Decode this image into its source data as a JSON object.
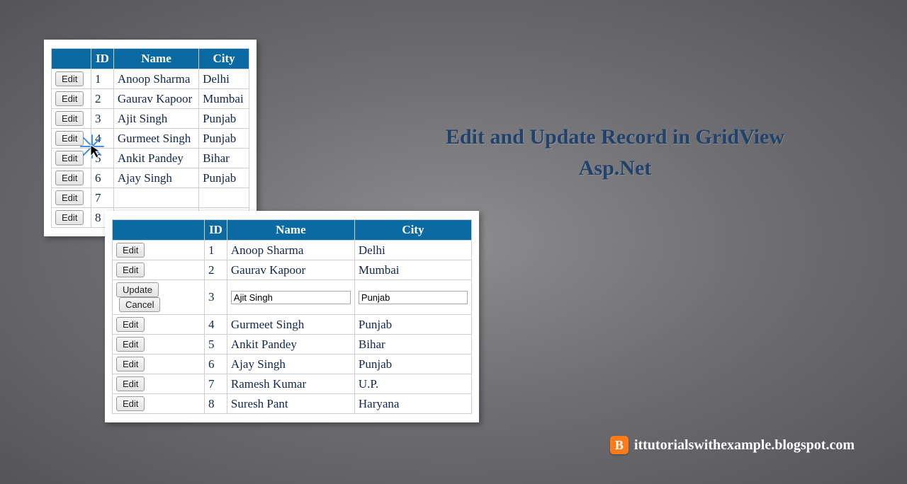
{
  "title_line1": "Edit and Update Record in GridView",
  "title_line2": "Asp.Net",
  "footer_site": "ittutorialswithexample.blogspot.com",
  "footer_badge": "B",
  "labels": {
    "edit": "Edit",
    "update": "Update",
    "cancel": "Cancel"
  },
  "gridA": {
    "headers": {
      "blank": "",
      "id": "ID",
      "name": "Name",
      "city": "City"
    },
    "rows": [
      {
        "id": "1",
        "name": "Anoop Sharma",
        "city": "Delhi"
      },
      {
        "id": "2",
        "name": "Gaurav Kapoor",
        "city": "Mumbai"
      },
      {
        "id": "3",
        "name": "Ajit Singh",
        "city": "Punjab"
      },
      {
        "id": "4",
        "name": "Gurmeet Singh",
        "city": "Punjab"
      },
      {
        "id": "5",
        "name": "Ankit Pandey",
        "city": "Bihar"
      },
      {
        "id": "6",
        "name": "Ajay Singh",
        "city": "Punjab"
      },
      {
        "id": "7",
        "name": "",
        "city": ""
      },
      {
        "id": "8",
        "name": "",
        "city": ""
      }
    ]
  },
  "gridB": {
    "headers": {
      "blank": "",
      "id": "ID",
      "name": "Name",
      "city": "City"
    },
    "editIndex": 2,
    "rows": [
      {
        "id": "1",
        "name": "Anoop Sharma",
        "city": "Delhi"
      },
      {
        "id": "2",
        "name": "Gaurav Kapoor",
        "city": "Mumbai"
      },
      {
        "id": "3",
        "name": "Ajit Singh",
        "city": "Punjab"
      },
      {
        "id": "4",
        "name": "Gurmeet Singh",
        "city": "Punjab"
      },
      {
        "id": "5",
        "name": "Ankit Pandey",
        "city": "Bihar"
      },
      {
        "id": "6",
        "name": "Ajay Singh",
        "city": "Punjab"
      },
      {
        "id": "7",
        "name": "Ramesh Kumar",
        "city": "U.P."
      },
      {
        "id": "8",
        "name": "Suresh Pant",
        "city": "Haryana"
      }
    ]
  }
}
